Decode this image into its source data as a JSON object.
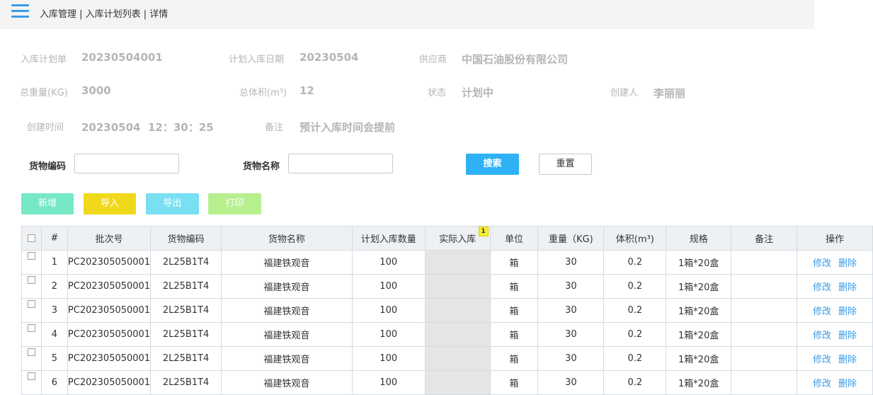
{
  "header": {
    "breadcrumb": "入库管理 | 入库计划列表 | 详情"
  },
  "info": {
    "plan_no_label": "入库计划单",
    "plan_no": "20230504001",
    "plan_date_label": "计划入库日期",
    "plan_date": "20230504",
    "supplier_label": "供应商",
    "supplier": "中国石油股份有限公司",
    "weight_label": "总重量(KG)",
    "weight": "3000",
    "volume_label": "总体积(m³)",
    "volume": "12",
    "status_label": "状态",
    "status": "计划中",
    "creator_label": "创建人",
    "creator": "李丽丽",
    "created_label": "创建时间",
    "created": "20230504  12：30：25",
    "remark_label": "备注",
    "remark": "预计入库时间会提前"
  },
  "search": {
    "code_label": "货物编码",
    "code_value": "",
    "name_label": "货物名称",
    "name_value": "",
    "search_button": "搜索",
    "reset_button": "重置"
  },
  "toolbar": {
    "add": "新增",
    "import": "导入",
    "export": "导出",
    "print": "打印"
  },
  "table": {
    "columns": [
      "#",
      "批次号",
      "货物编码",
      "货物名称",
      "计划入库数量",
      "实际入库",
      "单位",
      "重量（KG)",
      "体积(m³)",
      "规格",
      "备注",
      "操作"
    ],
    "actual_badge": "1",
    "edit_label": "修改",
    "delete_label": "删除",
    "rows": [
      {
        "no": "1",
        "batch": "PC202305050001",
        "code": "2L25B1T4",
        "name": "福建铁观音",
        "plan_qty": "100",
        "actual": "",
        "unit": "箱",
        "weight": "30",
        "volume": "0.2",
        "spec": "1箱*20盒",
        "remark": ""
      },
      {
        "no": "2",
        "batch": "PC202305050001",
        "code": "2L25B1T4",
        "name": "福建铁观音",
        "plan_qty": "100",
        "actual": "",
        "unit": "箱",
        "weight": "30",
        "volume": "0.2",
        "spec": "1箱*20盒",
        "remark": ""
      },
      {
        "no": "3",
        "batch": "PC202305050001",
        "code": "2L25B1T4",
        "name": "福建铁观音",
        "plan_qty": "100",
        "actual": "",
        "unit": "箱",
        "weight": "30",
        "volume": "0.2",
        "spec": "1箱*20盒",
        "remark": ""
      },
      {
        "no": "4",
        "batch": "PC202305050001",
        "code": "2L25B1T4",
        "name": "福建铁观音",
        "plan_qty": "100",
        "actual": "",
        "unit": "箱",
        "weight": "30",
        "volume": "0.2",
        "spec": "1箱*20盒",
        "remark": ""
      },
      {
        "no": "5",
        "batch": "PC202305050001",
        "code": "2L25B1T4",
        "name": "福建铁观音",
        "plan_qty": "100",
        "actual": "",
        "unit": "箱",
        "weight": "30",
        "volume": "0.2",
        "spec": "1箱*20盒",
        "remark": ""
      },
      {
        "no": "6",
        "batch": "PC202305050001",
        "code": "2L25B1T4",
        "name": "福建铁观音",
        "plan_qty": "100",
        "actual": "",
        "unit": "箱",
        "weight": "30",
        "volume": "0.2",
        "spec": "1箱*20盒",
        "remark": ""
      }
    ]
  }
}
